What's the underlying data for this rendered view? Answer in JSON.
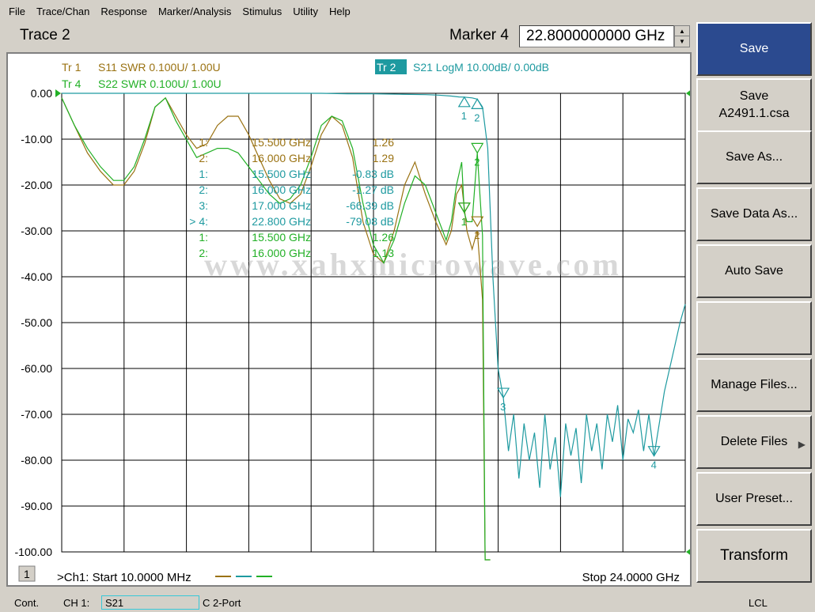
{
  "menu": [
    "File",
    "Trace/Chan",
    "Response",
    "Marker/Analysis",
    "Stimulus",
    "Utility",
    "Help"
  ],
  "header": {
    "trace_title": "Trace 2",
    "marker_label": "Marker 4",
    "marker_value": "22.8000000000 GHz"
  },
  "softkeys": [
    {
      "label": "Save",
      "sub": ""
    },
    {
      "label": "Save",
      "sub": "A2491.1.csa"
    },
    {
      "label": "Save As...",
      "sub": ""
    },
    {
      "label": "Save Data As...",
      "sub": ""
    },
    {
      "label": "Auto Save",
      "sub": ""
    },
    {
      "label": "",
      "sub": ""
    },
    {
      "label": "Manage Files...",
      "sub": ""
    },
    {
      "label": "Delete Files",
      "sub": ""
    },
    {
      "label": "User Preset...",
      "sub": ""
    },
    {
      "label": "Transform",
      "sub": ""
    }
  ],
  "colors": {
    "s11": "#9a7212",
    "s21": "#1e9aa0",
    "s22": "#22b026",
    "grid": "#000000"
  },
  "chart_data": {
    "type": "line",
    "traces": [
      {
        "label": "Tr  1",
        "text": "S11 SWR 0.100U/  1.00U",
        "color_key": "s11"
      },
      {
        "label": "Tr  2",
        "text": "S21 LogM 10.00dB/  0.00dB",
        "color_key": "s21"
      },
      {
        "label": "Tr  4",
        "text": "S22 SWR 0.100U/  1.00U",
        "color_key": "s22"
      }
    ],
    "y_ticks": [
      "0.00",
      "-10.00",
      "-20.00",
      "-30.00",
      "-40.00",
      "-50.00",
      "-60.00",
      "-70.00",
      "-80.00",
      "-90.00",
      "-100.00"
    ],
    "ylim": [
      -100,
      0
    ],
    "xlim_ghz": [
      0.01,
      24.0
    ],
    "x_divisions": 10,
    "start_label": ">Ch1: Start  10.0000 MHz",
    "stop_label": "Stop  24.0000 GHz",
    "channel_number": "1",
    "watermark": "www.xahxmicrowave.com",
    "marker_table": [
      {
        "num": "1:",
        "freq": "15.500 GHz",
        "value": "1.26",
        "trace": "s11"
      },
      {
        "num": "2:",
        "freq": "16.000 GHz",
        "value": "1.29",
        "trace": "s11"
      },
      {
        "num": "1:",
        "freq": "15.500 GHz",
        "value": "-0.83 dB",
        "trace": "s21"
      },
      {
        "num": "2:",
        "freq": "16.000 GHz",
        "value": "-1.27 dB",
        "trace": "s21"
      },
      {
        "num": "3:",
        "freq": "17.000 GHz",
        "value": "-66.39 dB",
        "trace": "s21"
      },
      {
        "num": "> 4:",
        "freq": "22.800 GHz",
        "value": "-79.08 dB",
        "trace": "s21"
      },
      {
        "num": "1:",
        "freq": "15.500 GHz",
        "value": "1.26",
        "trace": "s22"
      },
      {
        "num": "2:",
        "freq": "16.000 GHz",
        "value": "1.13",
        "trace": "s22"
      }
    ],
    "markers": [
      {
        "trace": "s21",
        "id": "1",
        "x": 15.5,
        "y": -0.83
      },
      {
        "trace": "s21",
        "id": "2",
        "x": 16.0,
        "y": -1.27
      },
      {
        "trace": "s21",
        "id": "3",
        "x": 17.0,
        "y": -66.39
      },
      {
        "trace": "s21",
        "id": "4",
        "x": 22.8,
        "y": -79.08
      },
      {
        "trace": "s11",
        "id": "1",
        "x": 15.5,
        "y": 1.26
      },
      {
        "trace": "s11",
        "id": "2",
        "x": 16.0,
        "y": 1.29
      },
      {
        "trace": "s22",
        "id": "1",
        "x": 15.5,
        "y": 1.26
      },
      {
        "trace": "s22",
        "id": "2",
        "x": 16.0,
        "y": 1.13
      }
    ],
    "s11_swr": {
      "x": [
        0.01,
        0.5,
        1.0,
        1.5,
        2.0,
        2.4,
        2.8,
        3.2,
        3.6,
        4.0,
        4.4,
        4.8,
        5.2,
        5.6,
        6.0,
        6.4,
        6.8,
        7.2,
        7.6,
        8.0,
        8.4,
        8.8,
        9.2,
        9.6,
        10.0,
        10.4,
        10.8,
        11.2,
        11.6,
        12.0,
        12.4,
        12.8,
        13.2,
        13.6,
        14.0,
        14.4,
        14.8,
        15.0,
        15.2,
        15.4,
        15.6,
        15.8,
        16.0,
        16.2,
        16.3,
        16.4,
        16.5
      ],
      "y": [
        1.01,
        1.07,
        1.13,
        1.17,
        1.2,
        1.2,
        1.17,
        1.11,
        1.03,
        1.01,
        1.05,
        1.09,
        1.12,
        1.11,
        1.07,
        1.05,
        1.05,
        1.09,
        1.14,
        1.19,
        1.23,
        1.24,
        1.22,
        1.16,
        1.09,
        1.05,
        1.07,
        1.14,
        1.28,
        1.35,
        1.37,
        1.3,
        1.2,
        1.15,
        1.22,
        1.28,
        1.33,
        1.3,
        1.22,
        1.2,
        1.3,
        1.34,
        1.3,
        1.45,
        2.4,
        3.2,
        2.8
      ]
    },
    "s22_swr": {
      "x": [
        0.01,
        0.5,
        1.0,
        1.5,
        2.0,
        2.4,
        2.8,
        3.2,
        3.6,
        4.0,
        4.4,
        4.8,
        5.2,
        5.6,
        6.0,
        6.4,
        6.8,
        7.2,
        7.6,
        8.0,
        8.4,
        8.8,
        9.2,
        9.6,
        10.0,
        10.4,
        10.8,
        11.2,
        11.6,
        12.0,
        12.4,
        12.8,
        13.2,
        13.6,
        14.0,
        14.4,
        14.8,
        15.0,
        15.2,
        15.4,
        15.5,
        15.6,
        15.8,
        16.0,
        16.2,
        16.3,
        16.4,
        16.5
      ],
      "y": [
        1.01,
        1.07,
        1.12,
        1.16,
        1.19,
        1.19,
        1.16,
        1.1,
        1.03,
        1.01,
        1.06,
        1.1,
        1.14,
        1.13,
        1.12,
        1.12,
        1.13,
        1.16,
        1.19,
        1.22,
        1.24,
        1.23,
        1.2,
        1.14,
        1.07,
        1.05,
        1.06,
        1.12,
        1.24,
        1.33,
        1.37,
        1.32,
        1.24,
        1.18,
        1.2,
        1.26,
        1.32,
        1.28,
        1.2,
        1.15,
        1.26,
        1.28,
        1.28,
        1.13,
        1.31,
        2.6,
        3.4,
        3.0
      ]
    },
    "s21_db": {
      "x": [
        0.01,
        1.0,
        2.0,
        3.0,
        4.0,
        5.0,
        6.0,
        7.0,
        8.0,
        9.0,
        10.0,
        11.0,
        12.0,
        13.0,
        14.0,
        14.5,
        15.0,
        15.3,
        15.5,
        15.8,
        16.0,
        16.2,
        16.4,
        16.6,
        16.8,
        17.0,
        17.2,
        17.4,
        17.6,
        17.8,
        18.0,
        18.2,
        18.4,
        18.6,
        18.8,
        19.0,
        19.2,
        19.4,
        19.6,
        19.8,
        20.0,
        20.2,
        20.4,
        20.6,
        20.8,
        21.0,
        21.2,
        21.4,
        21.6,
        21.8,
        22.0,
        22.2,
        22.4,
        22.6,
        22.8,
        23.0,
        23.2,
        23.4,
        23.6,
        23.8,
        24.0
      ],
      "y": [
        0.0,
        0.0,
        0.0,
        0.0,
        0.0,
        0.0,
        0.0,
        0.0,
        0.0,
        0.0,
        0.0,
        -0.1,
        -0.1,
        -0.2,
        -0.3,
        -0.4,
        -0.6,
        -0.8,
        -0.83,
        -1.0,
        -1.27,
        -3,
        -12,
        -40,
        -60,
        -66.39,
        -78,
        -70,
        -84,
        -72,
        -80,
        -74,
        -86,
        -70,
        -82,
        -75,
        -88,
        -72,
        -79,
        -73,
        -85,
        -70,
        -78,
        -72,
        -82,
        -70,
        -76,
        -68,
        -80,
        -71,
        -74,
        -69,
        -78,
        -70,
        -79.08,
        -72,
        -65,
        -60,
        -55,
        -50,
        -46
      ]
    }
  },
  "status": {
    "mode": "Cont.",
    "channel": "CH 1:",
    "measurement": "S21",
    "correction": "C  2-Port",
    "remote": "LCL"
  }
}
